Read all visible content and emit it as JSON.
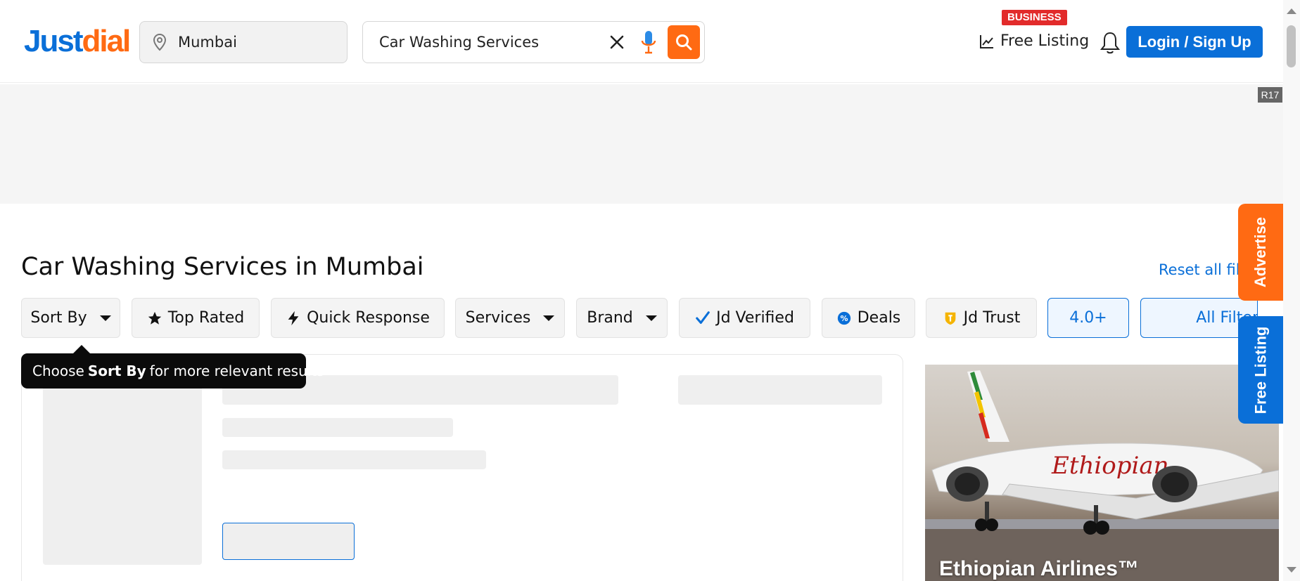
{
  "brand": {
    "logo_part1": "Just",
    "logo_part2": "dial"
  },
  "header": {
    "location_value": "Mumbai",
    "search_value": "Car Washing Services",
    "business_badge": "BUSINESS",
    "free_listing_label": "Free Listing",
    "login_label": "Login / Sign Up"
  },
  "ad_band": {
    "tag": "R17"
  },
  "main": {
    "title": "Car Washing Services in Mumbai",
    "reset_label": "Reset all fil"
  },
  "filters": [
    {
      "label": "Sort By",
      "icon": "caret-down-icon"
    },
    {
      "label": "Top Rated",
      "icon": "star-icon"
    },
    {
      "label": "Quick Response",
      "icon": "lightning-icon"
    },
    {
      "label": "Services",
      "icon": "caret-down-icon"
    },
    {
      "label": "Brand",
      "icon": "caret-down-icon"
    },
    {
      "label": "Jd Verified",
      "icon": "check-icon"
    },
    {
      "label": "Deals",
      "icon": "deals-percent-icon"
    },
    {
      "label": "Jd Trust",
      "icon": "trust-shield-icon"
    },
    {
      "label": "4.0+",
      "icon": ""
    },
    {
      "label": "All Filter",
      "icon": ""
    }
  ],
  "tooltip": {
    "prefix": "Choose",
    "bold": "Sort By",
    "suffix": "for more relevant results"
  },
  "side_ad": {
    "caption": "Ethiopian Airlines™"
  },
  "side_tabs": {
    "advertise": "Advertise",
    "free_listing": "Free Listing"
  },
  "colors": {
    "brand_blue": "#0a6fd8",
    "brand_orange": "#ff6a13",
    "badge_red": "#e22b2b"
  }
}
